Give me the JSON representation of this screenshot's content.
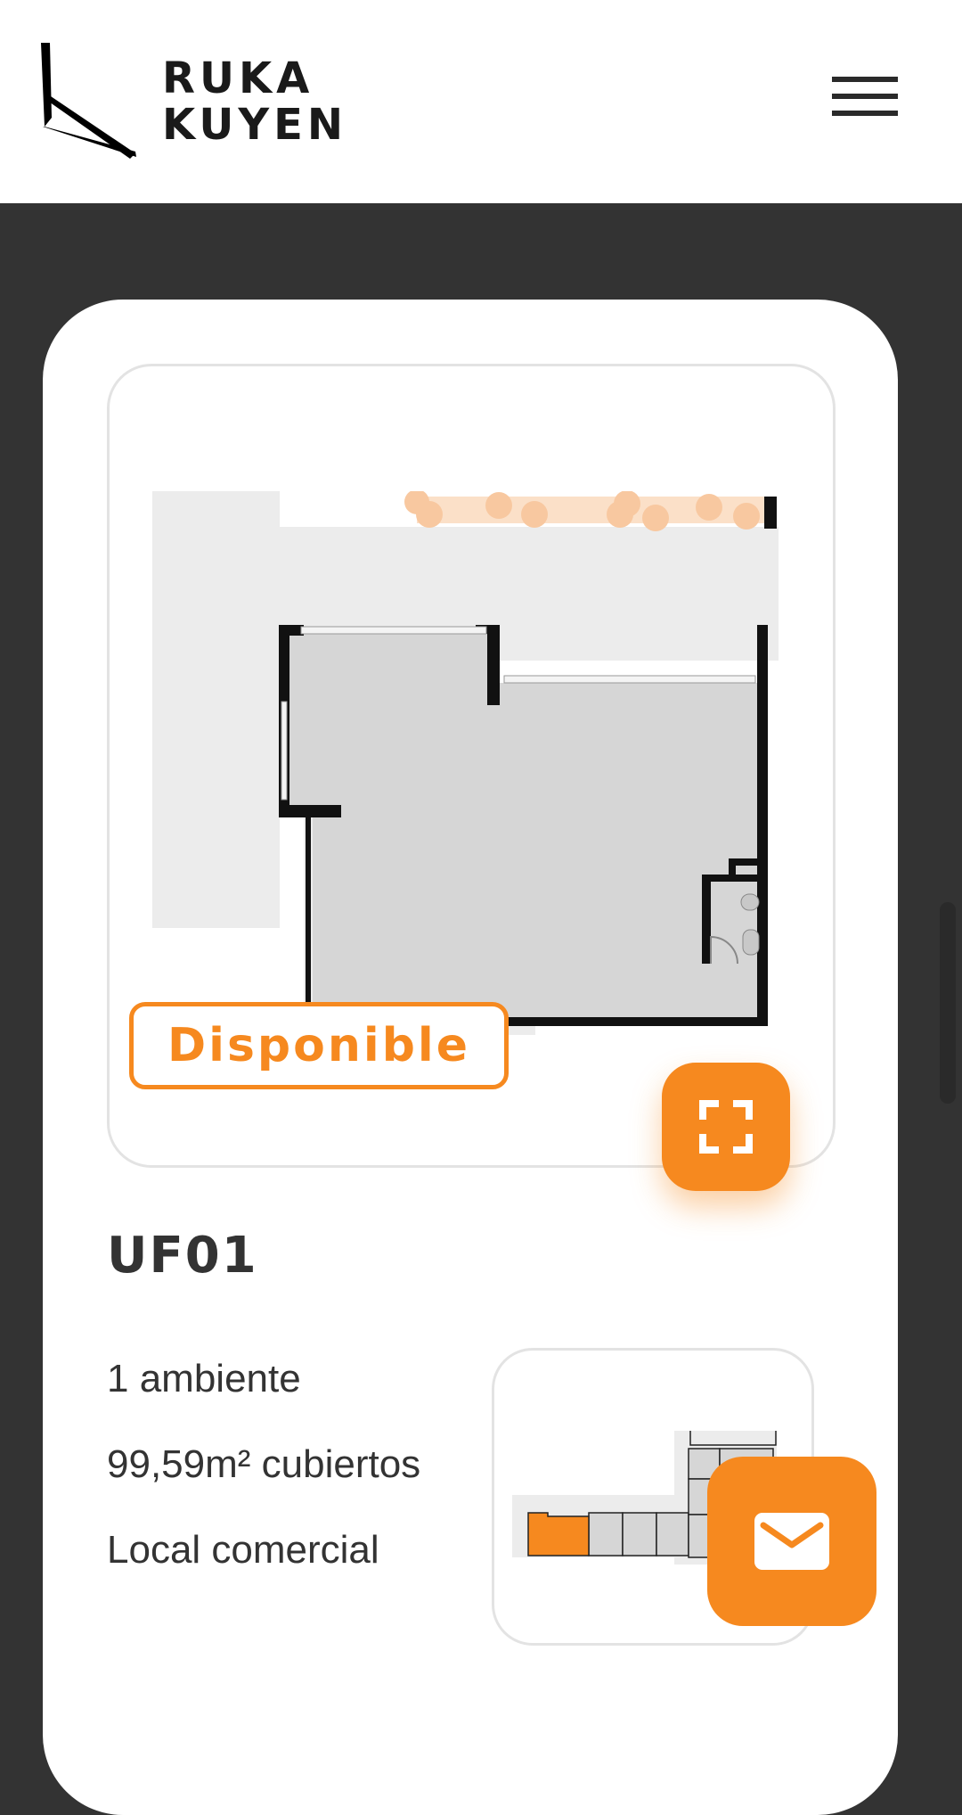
{
  "brand": {
    "line1": "RUKA",
    "line2": "KUYEN"
  },
  "header": {
    "menu_icon": "hamburger-menu-icon"
  },
  "unit": {
    "status": "Disponible",
    "code": "UF01",
    "specs": [
      "1 ambiente",
      "99,59m² cubiertos",
      "Local comercial"
    ]
  },
  "icons": {
    "expand": "fullscreen-icon",
    "contact": "mail-icon"
  },
  "colors": {
    "accent": "#f6891f",
    "dark_bg": "#333333",
    "text": "#333333"
  }
}
